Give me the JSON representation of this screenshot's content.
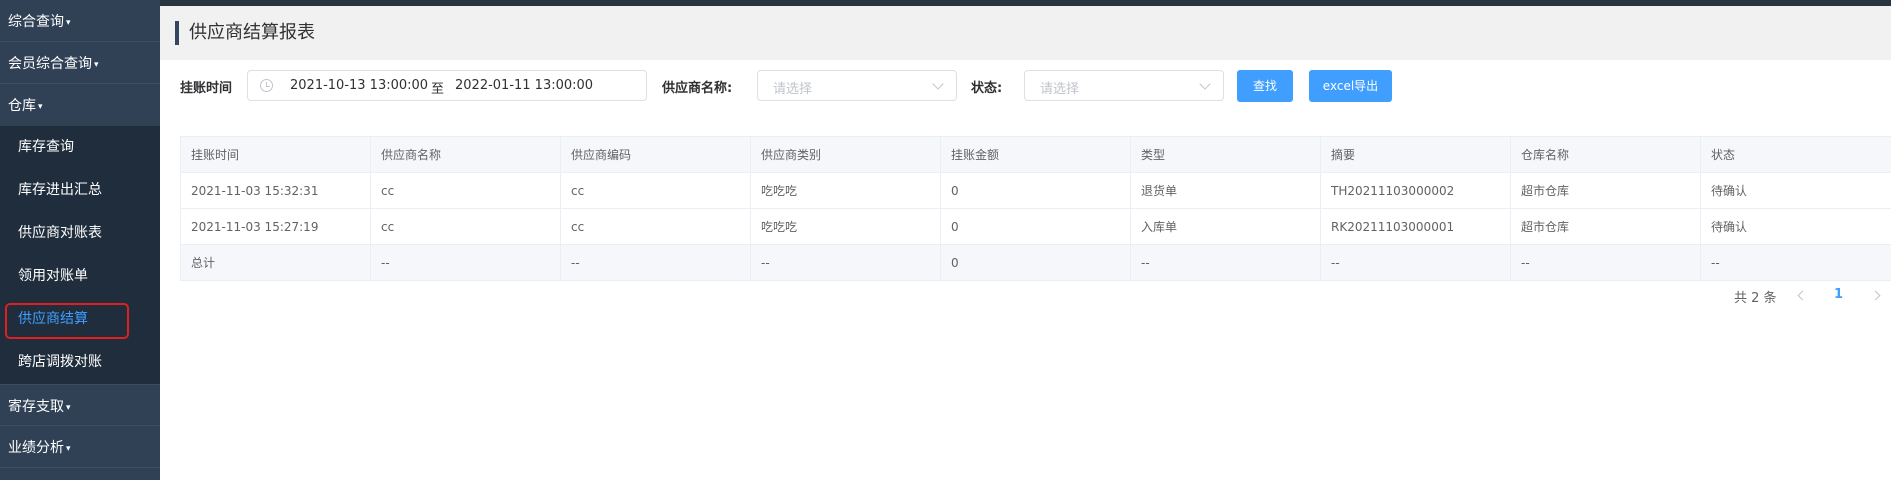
{
  "sidebar": {
    "top_groups": [
      {
        "label": "综合查询"
      },
      {
        "label": "会员综合查询"
      },
      {
        "label": "仓库"
      }
    ],
    "warehouse_items": [
      {
        "label": "库存查询"
      },
      {
        "label": "库存进出汇总"
      },
      {
        "label": "供应商对账表"
      },
      {
        "label": "领用对账单"
      },
      {
        "label": "供应商结算"
      },
      {
        "label": "跨店调拨对账"
      }
    ],
    "bottom_groups": [
      {
        "label": "寄存支取"
      },
      {
        "label": "业绩分析"
      }
    ],
    "caret": "▾"
  },
  "header": {
    "title": "供应商结算报表"
  },
  "filters": {
    "date_label": "挂账时间",
    "date_start": "2021-10-13 13:00:00",
    "date_separator": "至",
    "date_end": "2022-01-11 13:00:00",
    "supplier_label": "供应商名称:",
    "supplier_placeholder": "请选择",
    "status_label": "状态:",
    "status_placeholder": "请选择",
    "search_label": "查找",
    "export_label": "excel导出"
  },
  "table": {
    "columns": [
      "挂账时间",
      "供应商名称",
      "供应商编码",
      "供应商类别",
      "挂账金额",
      "类型",
      "摘要",
      "仓库名称",
      "状态"
    ],
    "rows": [
      [
        "2021-11-03 15:32:31",
        "cc",
        "cc",
        "吃吃吃",
        "0",
        "退货单",
        "TH20211103000002",
        "超市仓库",
        "待确认"
      ],
      [
        "2021-11-03 15:27:19",
        "cc",
        "cc",
        "吃吃吃",
        "0",
        "入库单",
        "RK20211103000001",
        "超市仓库",
        "待确认"
      ]
    ],
    "summary": [
      "总计",
      "--",
      "--",
      "--",
      "0",
      "--",
      "--",
      "--",
      "--"
    ]
  },
  "pagination": {
    "total": "共 2 条",
    "current_page": "1"
  },
  "colors": {
    "sidebar_bg": "#304156",
    "submenu_bg": "#1f2d3d",
    "primary": "#409eff",
    "active_highlight": "#e02020"
  }
}
